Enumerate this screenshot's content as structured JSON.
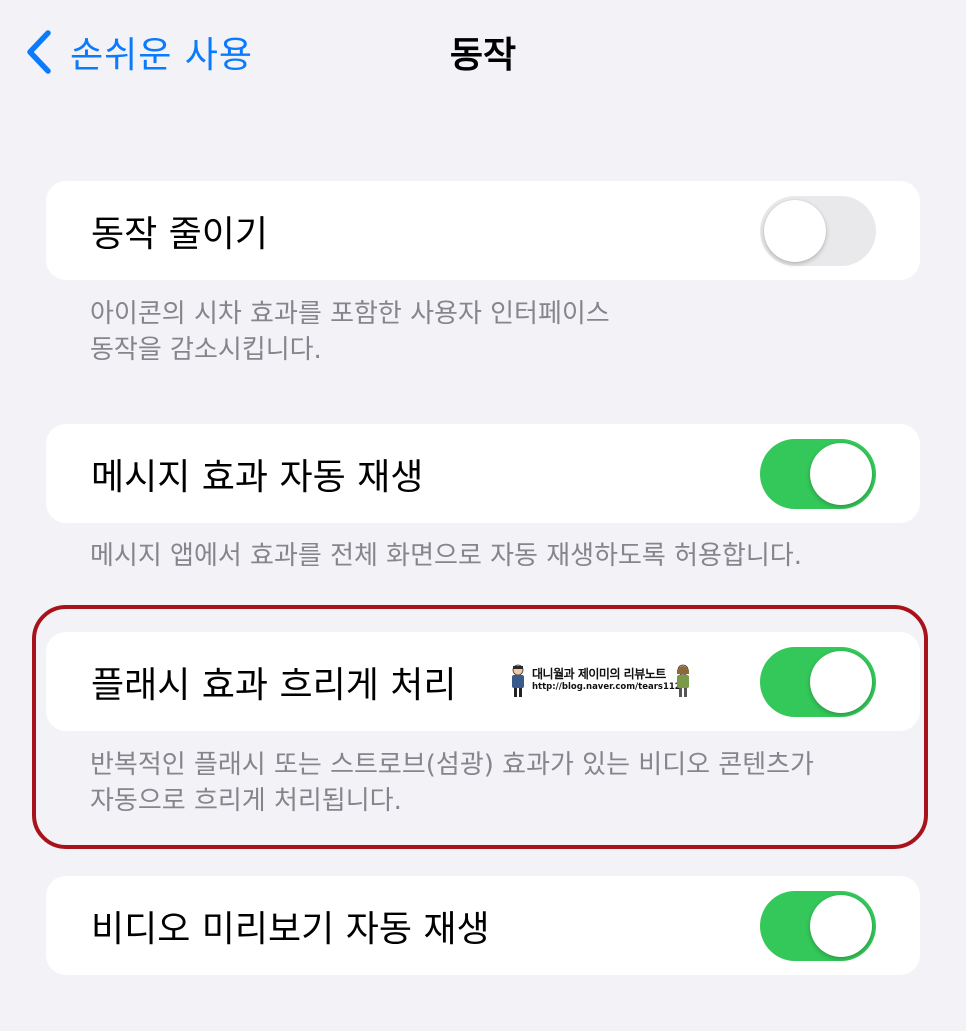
{
  "nav": {
    "back_label": "손쉬운 사용",
    "title": "동작"
  },
  "settings": [
    {
      "label": "동작 줄이기",
      "enabled": false,
      "footer": [
        "아이콘의 시차 효과를 포함한 사용자 인터페이스",
        "동작을 감소시킵니다."
      ]
    },
    {
      "label": "메시지 효과 자동 재생",
      "enabled": true,
      "footer": [
        "메시지 앱에서 효과를 전체 화면으로 자동 재생하도록 허용합니다."
      ]
    },
    {
      "label": "플래시 효과 흐리게 처리",
      "enabled": true,
      "footer": [
        "반복적인 플래시 또는 스트로브(섬광) 효과가 있는 비디오 콘텐츠가",
        "자동으로 흐리게 처리됩니다."
      ]
    },
    {
      "label": "비디오 미리보기 자동 재생",
      "enabled": true
    }
  ],
  "watermark": {
    "title": "대니월과 제이미의 리뷰노트",
    "url": "http://blog.naver.com/tears1124"
  },
  "colors": {
    "accent": "#0a7aff",
    "toggle_on": "#34c759",
    "toggle_off": "#e9e9eb",
    "highlight_border": "#a8131b",
    "background": "#f2f2f7",
    "footer_text": "#85858b"
  },
  "icons": {
    "back": "chevron-left-icon"
  }
}
